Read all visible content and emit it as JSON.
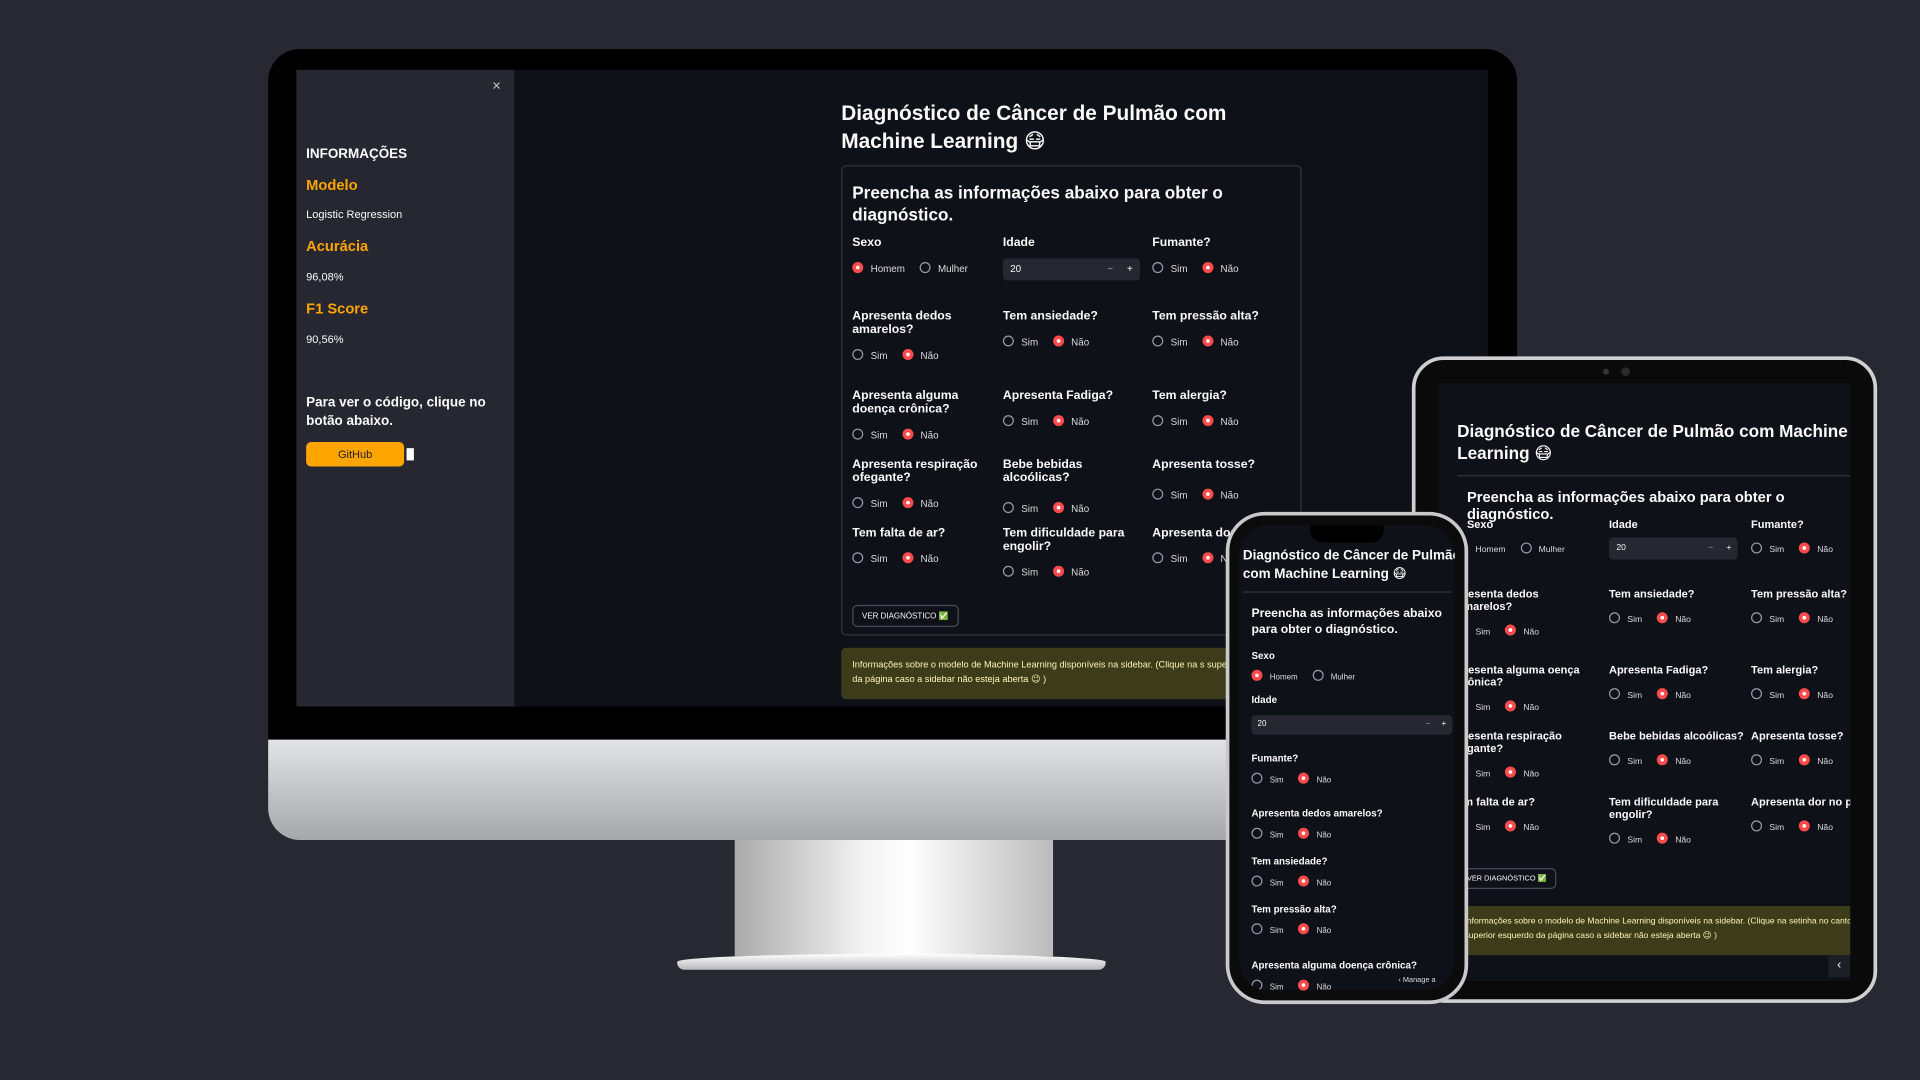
{
  "app": {
    "title": "Diagnóstico de Câncer de Pulmão com Machine Learning",
    "title_emoji": "😷",
    "form_heading": "Preencha as informações abaixo para obter o diagnóstico.",
    "submit_label": "VER DIAGNÓSTICO",
    "submit_emoji": "✅",
    "info_text": "Informações sobre o modelo de Machine Learning disponíveis na sidebar. (Clique na setinha no canto superior esquerdo da página caso a sidebar não esteja aberta 😉 )",
    "info_text_monitor": "Informações sobre o modelo de Machine Learning disponíveis na sidebar. (Clique na s superior esquerdo da página caso a sidebar não esteja aberta 😉 )"
  },
  "sidebar": {
    "close_glyph": "×",
    "section_title": "INFORMAÇÕES",
    "model_label": "Modelo",
    "model_value": "Logistic Regression",
    "accuracy_label": "Acurácia",
    "accuracy_value": "96,08%",
    "f1_label": "F1 Score",
    "f1_value": "90,56%",
    "code_text": "Para ver o código, clique no botão abaixo.",
    "github_label": "GitHub"
  },
  "options": {
    "yes": "Sim",
    "no": "Não",
    "male": "Homem",
    "female": "Mulher"
  },
  "fields": {
    "sex": "Sexo",
    "age": "Idade",
    "age_value": "20",
    "smoker": "Fumante?",
    "yellow_fingers": "Apresenta dedos amarelos?",
    "anxiety": "Tem ansiedade?",
    "high_bp": "Tem pressão alta?",
    "chronic": "Apresenta alguma doença crônica?",
    "fatigue": "Apresenta Fadiga?",
    "allergy": "Tem alergia?",
    "wheezing": "Apresenta respiração ofegante?",
    "alcohol": "Bebe bebidas alcoólicas?",
    "cough": "Apresenta tosse?",
    "short_breath": "Tem falta de ar?",
    "swallow": "Tem dificuldade para engolir?",
    "chest_pain_cut": "Apresenta dor",
    "chest_pain_tab": "Apresenta dor no pe"
  },
  "tablet_cut": {
    "yellow_fingers": "presenta dedos amarelos?",
    "chronic": "presenta alguma oença crônica?",
    "wheezing": "presenta respiração fegante?",
    "short_breath": "em falta de ar?"
  },
  "stepper": {
    "minus": "−",
    "plus": "+"
  },
  "phone": {
    "manage": "Manage a",
    "chevron": "‹"
  },
  "colors": {
    "accent": "#ffa500",
    "radio_on": "#ff4b4b",
    "bg": "#0e1117",
    "sidebar": "#262730",
    "page_bg": "#272832"
  }
}
